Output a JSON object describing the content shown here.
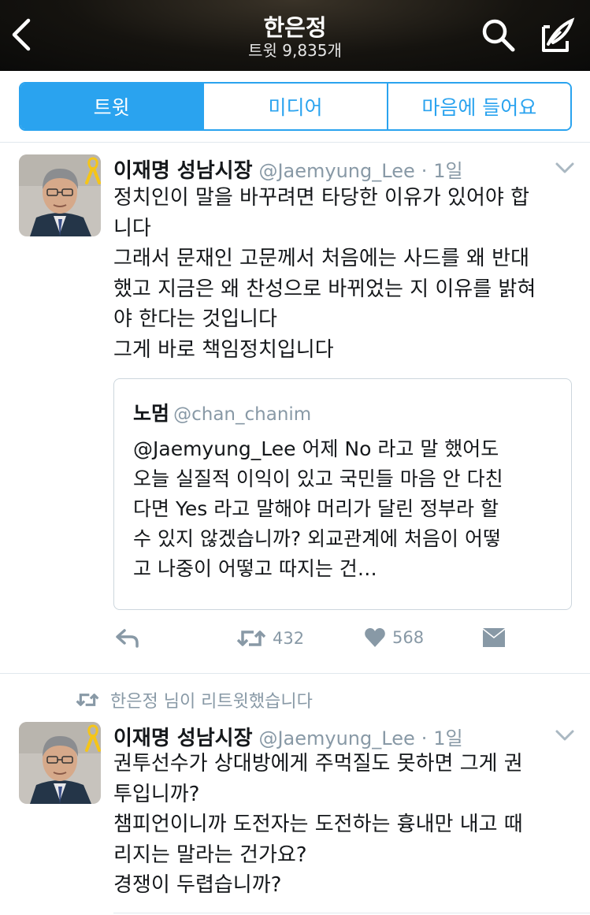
{
  "header": {
    "title": "한은정",
    "subtitle": "트윗 9,835개",
    "back_icon": "chevron-left-icon",
    "search_icon": "search-icon",
    "compose_icon": "compose-icon"
  },
  "tabs": [
    {
      "label": "트윗",
      "active": true
    },
    {
      "label": "미디어",
      "active": false
    },
    {
      "label": "마음에 들어요",
      "active": false
    }
  ],
  "tweets": [
    {
      "name": "이재명 성남시장",
      "handle": "@Jaemyung_Lee",
      "dot": "·",
      "time": "1일",
      "lines": [
        "정치인이 말을 바꾸려면 타당한 이유가 있어야 합",
        "니다",
        "그래서 문재인 고문께서 처음에는 사드를 왜 반대",
        "했고 지금은 왜 찬성으로 바뀌었는 지 이유를 밝혀",
        "야 한다는 것입니다",
        "그게 바로 책임정치입니다"
      ],
      "quote": {
        "name": "노멈",
        "handle": "@chan_chanim",
        "lines": [
          "@Jaemyung_Lee 어제 No 라고 말 했어도",
          "오늘 실질적 이익이 있고 국민들 마음 안 다친",
          "다면 Yes 라고 말해야 머리가 달린 정부라 할",
          "수 있지 않겠습니까? 외교관계에 처음이 어떻",
          "고 나중이 어떻고 따지는 건…"
        ]
      },
      "retweets": "432",
      "likes": "568"
    },
    {
      "retweet_context": "한은정 님이 리트윗했습니다",
      "name": "이재명 성남시장",
      "handle": "@Jaemyung_Lee",
      "dot": "·",
      "time": "1일",
      "lines": [
        "권투선수가 상대방에게 주먹질도 못하면 그게 권",
        "투입니까?",
        "챔피언이니까 도전자는 도전하는 흉내만 내고 때",
        "리지는 말라는 건가요?",
        "경쟁이 두렵습니까?"
      ]
    }
  ],
  "colors": {
    "accent": "#2aa3ef",
    "muted": "#8899a6",
    "ribbon": "#f5c518"
  }
}
